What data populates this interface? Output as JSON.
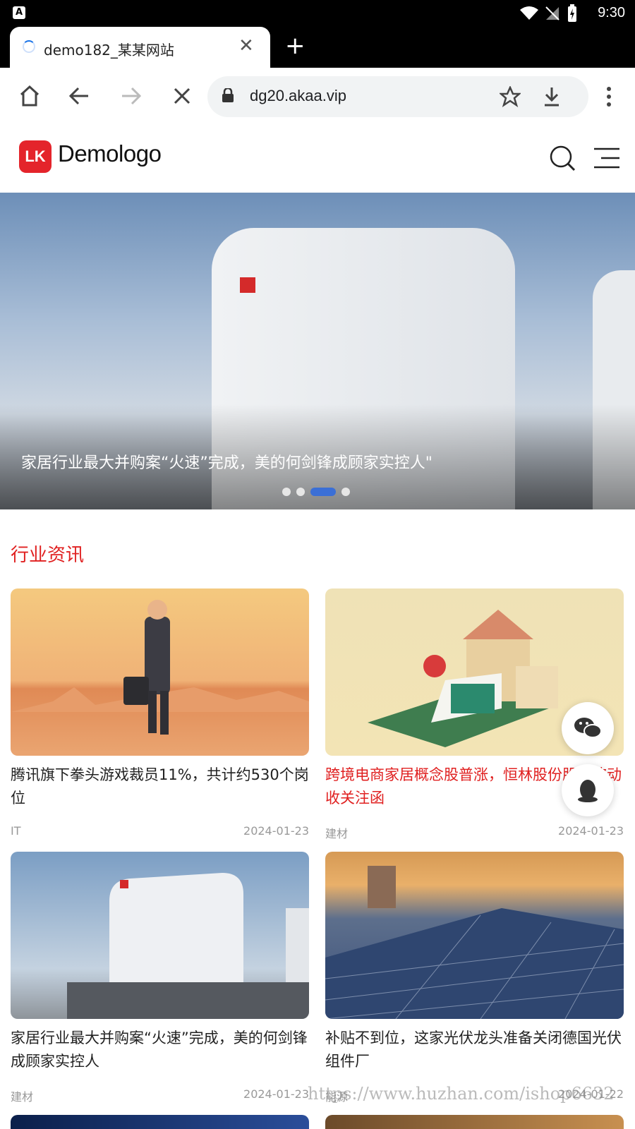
{
  "status_bar": {
    "time": "9:30",
    "notification_icon": "A"
  },
  "browser": {
    "tab_title": "demo182_某某网站",
    "url": "dg20.akaa.vip"
  },
  "site": {
    "logo_mark": "LK",
    "logo_text": "Demologo"
  },
  "hero": {
    "caption": "家居行业最大并购案“火速”完成，美的何剑锋成顾家实控人\"",
    "slides_count": 4,
    "active_slide": 3
  },
  "section": {
    "title": "行业资讯"
  },
  "articles": [
    {
      "title": "腾讯旗下拳头游戏裁员11%，共计约530个岗位",
      "category": "IT",
      "date": "2024-01-23",
      "highlighted": false
    },
    {
      "title": "跨境电商家居概念股普涨，恒林股份股价波动收关注函",
      "category": "建材",
      "date": "2024-01-23",
      "highlighted": true
    },
    {
      "title": "家居行业最大并购案“火速”完成，美的何剑锋成顾家实控人",
      "category": "建材",
      "date": "2024-01-23",
      "highlighted": false
    },
    {
      "title": "补贴不到位，这家光伏龙头准备关闭德国光伏组件厂",
      "category": "能源",
      "date": "2024-01-22",
      "highlighted": false
    }
  ],
  "floating": {
    "wechat_icon": "wechat-icon",
    "qq_icon": "qq-icon"
  },
  "watermark": "https://www.huzhan.com/ishop6632",
  "colors": {
    "accent": "#e02020",
    "brand": "#e4242b",
    "slider_active": "#3b6fd6"
  }
}
